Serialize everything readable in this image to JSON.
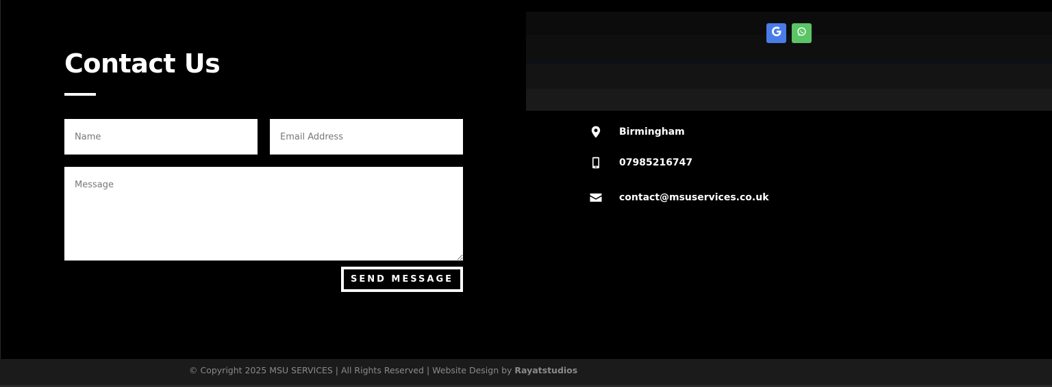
{
  "contact": {
    "title": "Contact Us",
    "name_placeholder": "Name",
    "email_placeholder": "Email Address",
    "message_placeholder": "Message",
    "send_label": "SEND MESSAGE"
  },
  "social": {
    "google_color": "#4a7ce8",
    "whatsapp_color": "#5ac466",
    "icons": [
      "google-icon",
      "whatsapp-icon"
    ]
  },
  "info": {
    "location": "Birmingham",
    "phone": "07985216747",
    "email": "contact@msuservices.co.uk",
    "icons": [
      "map-pin-icon",
      "mobile-phone-icon",
      "envelope-icon"
    ]
  },
  "footer": {
    "copyright_text": "© Copyright 2025 MSU SERVICES | All Rights Reserved | Website Design by ",
    "designer": "Rayatstudios"
  },
  "colors": {
    "background": "#000000",
    "footer_background": "#1b1b1b",
    "text": "#ffffff"
  }
}
